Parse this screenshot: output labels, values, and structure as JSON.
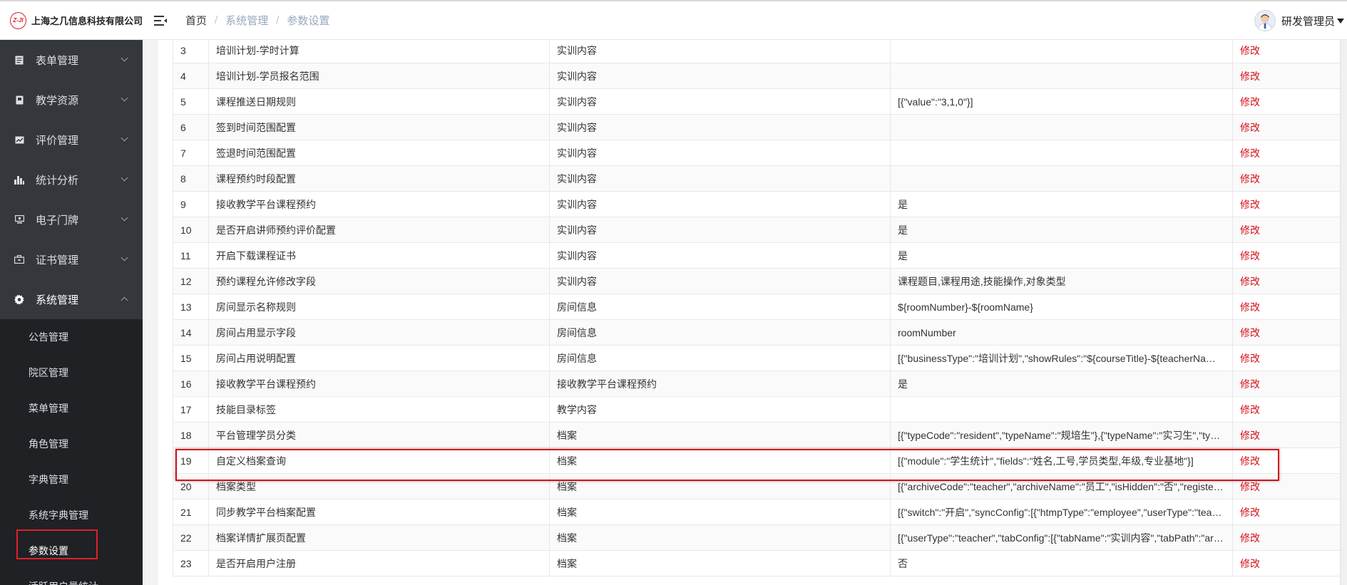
{
  "app": {
    "company": "上海之几信息科技有限公司",
    "logo_mark": "Z-JI"
  },
  "breadcrumb": {
    "home": "首页",
    "section": "系统管理",
    "page": "参数设置",
    "sep": "/"
  },
  "user": {
    "name": "研发管理员"
  },
  "sidebar": {
    "groups": [
      {
        "label": "表单管理",
        "icon": "form-icon"
      },
      {
        "label": "教学资源",
        "icon": "book-icon"
      },
      {
        "label": "评价管理",
        "icon": "chart-card-icon"
      },
      {
        "label": "统计分析",
        "icon": "bar-chart-icon"
      },
      {
        "label": "电子门牌",
        "icon": "monitor-icon"
      },
      {
        "label": "证书管理",
        "icon": "briefcase-icon"
      },
      {
        "label": "系统管理",
        "icon": "gear-icon"
      }
    ],
    "sub_items": [
      "公告管理",
      "院区管理",
      "菜单管理",
      "角色管理",
      "字典管理",
      "系统字典管理",
      "参数设置",
      "活跃用户量统计"
    ],
    "active_sub": "参数设置"
  },
  "table": {
    "action_label": "修改",
    "rows": [
      {
        "no": "3",
        "name": "培训计划-学时计算",
        "category": "实训内容",
        "value": ""
      },
      {
        "no": "4",
        "name": "培训计划-学员报名范围",
        "category": "实训内容",
        "value": ""
      },
      {
        "no": "5",
        "name": "课程推送日期规则",
        "category": "实训内容",
        "value": "[{\"value\":\"3,1,0\"}]"
      },
      {
        "no": "6",
        "name": "签到时间范围配置",
        "category": "实训内容",
        "value": ""
      },
      {
        "no": "7",
        "name": "签退时间范围配置",
        "category": "实训内容",
        "value": ""
      },
      {
        "no": "8",
        "name": "课程预约时段配置",
        "category": "实训内容",
        "value": ""
      },
      {
        "no": "9",
        "name": "接收教学平台课程预约",
        "category": "实训内容",
        "value": "是"
      },
      {
        "no": "10",
        "name": "是否开启讲师预约评价配置",
        "category": "实训内容",
        "value": "是"
      },
      {
        "no": "11",
        "name": "开启下载课程证书",
        "category": "实训内容",
        "value": "是"
      },
      {
        "no": "12",
        "name": "预约课程允许修改字段",
        "category": "实训内容",
        "value": "课程题目,课程用途,技能操作,对象类型"
      },
      {
        "no": "13",
        "name": "房间显示名称规则",
        "category": "房间信息",
        "value": "${roomNumber}-${roomName}"
      },
      {
        "no": "14",
        "name": "房间占用显示字段",
        "category": "房间信息",
        "value": "roomNumber"
      },
      {
        "no": "15",
        "name": "房间占用说明配置",
        "category": "房间信息",
        "value": "[{\"businessType\":\"培训计划\",\"showRules\":\"${courseTitle}-${teacherNa…"
      },
      {
        "no": "16",
        "name": "接收教学平台课程预约",
        "category": "接收教学平台课程预约",
        "value": "是"
      },
      {
        "no": "17",
        "name": "技能目录标签",
        "category": "教学内容",
        "value": ""
      },
      {
        "no": "18",
        "name": "平台管理学员分类",
        "category": "档案",
        "value": "[{\"typeCode\":\"resident\",\"typeName\":\"规培生\"},{\"typeName\":\"实习生\",\"ty…"
      },
      {
        "no": "19",
        "name": "自定义档案查询",
        "category": "档案",
        "value": "[{\"module\":\"学生统计\",\"fields\":\"姓名,工号,学员类型,年级,专业基地\"}]"
      },
      {
        "no": "20",
        "name": "档案类型",
        "category": "档案",
        "value": "[{\"archiveCode\":\"teacher\",\"archiveName\":\"员工\",\"isHidden\":\"否\",\"registe…"
      },
      {
        "no": "21",
        "name": "同步教学平台档案配置",
        "category": "档案",
        "value": "[{\"switch\":\"开启\",\"syncConfig\":[{\"htmpType\":\"employee\",\"userType\":\"tea…"
      },
      {
        "no": "22",
        "name": "档案详情扩展页配置",
        "category": "档案",
        "value": "[{\"userType\":\"teacher\",\"tabConfig\":[{\"tabName\":\"实训内容\",\"tabPath\":\"ar…"
      },
      {
        "no": "23",
        "name": "是否开启用户注册",
        "category": "档案",
        "value": "否"
      }
    ]
  },
  "colors": {
    "sidebar_bg": "#34373c",
    "submenu_bg": "#1f2124",
    "accent_red": "#d4101a",
    "breadcrumb_link": "#97a8be"
  }
}
